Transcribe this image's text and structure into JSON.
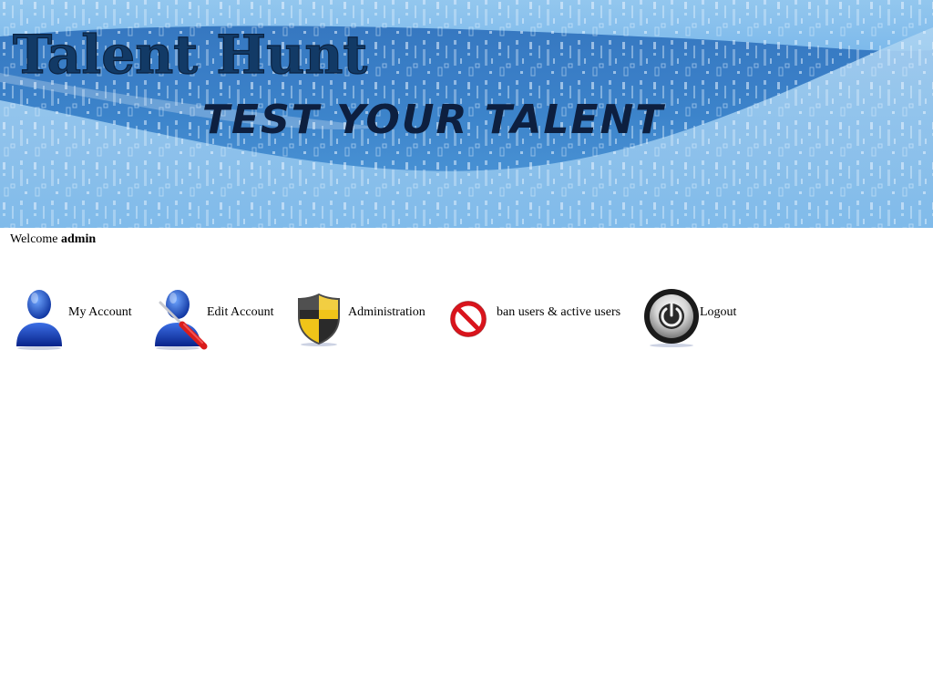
{
  "banner": {
    "logo_text": "Talent Hunt",
    "tagline": "TEST YOUR TALENT"
  },
  "welcome": {
    "greeting": "Welcome",
    "username": "admin"
  },
  "nav": {
    "items": [
      {
        "label": "My Account",
        "icon": "user-icon"
      },
      {
        "label": "Edit Account",
        "icon": "user-edit-icon"
      },
      {
        "label": "Administration",
        "icon": "shield-icon"
      },
      {
        "label": "ban users & active users",
        "icon": "ban-icon"
      },
      {
        "label": "Logout",
        "icon": "power-icon"
      }
    ]
  },
  "colors": {
    "banner_blue": "#3d8fd6",
    "banner_dark_blue": "#1f66b8",
    "shield_yellow": "#f0c419",
    "ban_red": "#d9141c"
  }
}
